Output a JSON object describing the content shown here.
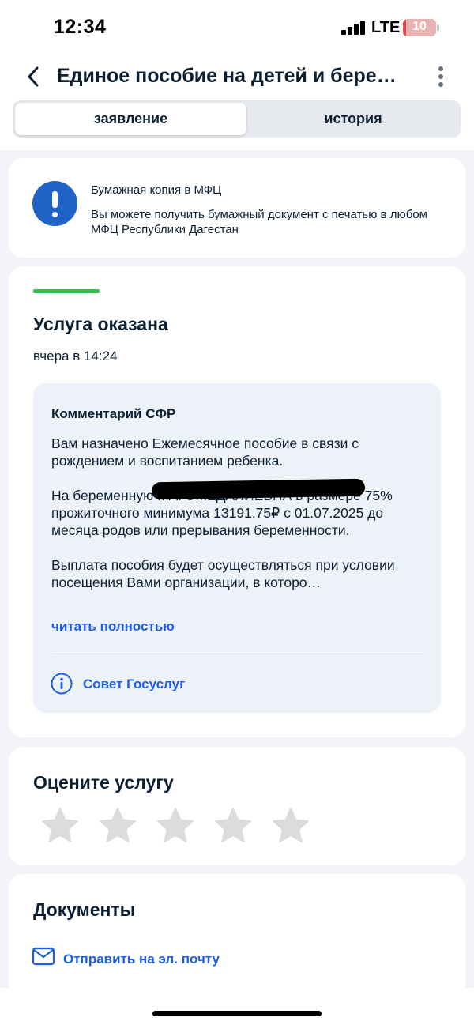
{
  "status_bar": {
    "time": "12:34",
    "network": "LTE",
    "battery": "10",
    "battery_level": 0.1,
    "icons": [
      "signal-icon",
      "battery-icon"
    ]
  },
  "header": {
    "title": "Единое пособие на детей и бере…",
    "icons": [
      "back-chevron-icon",
      "more-vertical-icon"
    ]
  },
  "tabs": [
    {
      "label": "заявление",
      "active": true
    },
    {
      "label": "история",
      "active": false
    }
  ],
  "info_notice": {
    "icon": "exclamation-icon",
    "title": "Бумажная копия в МФЦ",
    "text": "Вы можете получить бумажный документ с печатью в любом МФЦ Республики Дагестан",
    "accent_color": "#1f63c6"
  },
  "status": {
    "progress": 1.0,
    "progress_color": "#2fc14b",
    "title": "Услуга оказана",
    "time": "вчера в 14:24",
    "comment": {
      "title": "Комментарий СФР",
      "paragraphs": [
        "Вам назначено Ежемесячное пособие в связи с рождением и воспитанием ребенка.",
        "На беременную                                          МАГОМЕДАЛИЕВНА в размере 75% прожиточного минимума 13191.75₽ с 01.07.2025 до месяца родов или прерывания беременности.",
        "Выплата пособия будет осуществляться при условии посещения Вами организации, в которо…"
      ],
      "read_more": "читать полностью",
      "advice_label": "Совет Госуслуг",
      "advice_icon": "info-circle-icon"
    }
  },
  "rating": {
    "title": "Оцените услугу",
    "stars_total": 5,
    "stars_selected": 0,
    "star_color": "#dcdcdc"
  },
  "documents": {
    "title": "Документы",
    "send_email_label": "Отправить на эл. почту",
    "icon": "mail-icon"
  },
  "colors": {
    "link": "#1d5deb",
    "text": "#0b1f33",
    "background": "#f2f4f7"
  }
}
